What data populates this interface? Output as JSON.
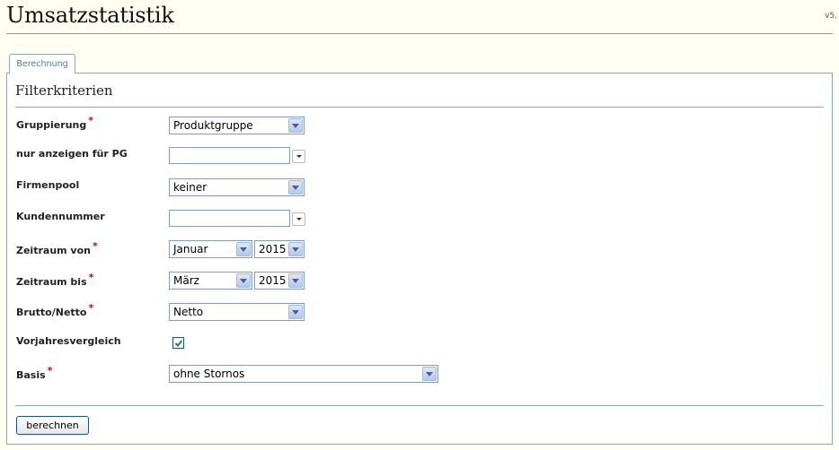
{
  "header": {
    "title": "Umsatzstatistik",
    "version": "v5."
  },
  "tabs": [
    {
      "label": "Berechnung"
    }
  ],
  "section": {
    "title": "Filterkriterien"
  },
  "required_marker": "*",
  "fields": {
    "gruppierung": {
      "label": "Gruppierung",
      "value": "Produktgruppe"
    },
    "nur_anzeigen_pg": {
      "label": "nur anzeigen für PG",
      "value": ""
    },
    "firmenpool": {
      "label": "Firmenpool",
      "value": "keiner"
    },
    "kundennummer": {
      "label": "Kundennummer",
      "value": ""
    },
    "zeitraum_von": {
      "label": "Zeitraum von",
      "month": "Januar",
      "year": "2015"
    },
    "zeitraum_bis": {
      "label": "Zeitraum bis",
      "month": "März",
      "year": "2015"
    },
    "brutto_netto": {
      "label": "Brutto/Netto",
      "value": "Netto"
    },
    "vorjahresvergleich": {
      "label": "Vorjahresvergleich",
      "checked": true
    },
    "basis": {
      "label": "Basis",
      "value": "ohne Stornos"
    }
  },
  "actions": {
    "compute_label": "berechnen"
  },
  "icons": {
    "dropdown": "chevron-down-icon",
    "checkmark": "checkmark-icon"
  },
  "colors": {
    "border": "#8aa9bd",
    "required": "#dd0000",
    "background": "#fefef2",
    "checkbox_check": "#2a8a2a"
  }
}
